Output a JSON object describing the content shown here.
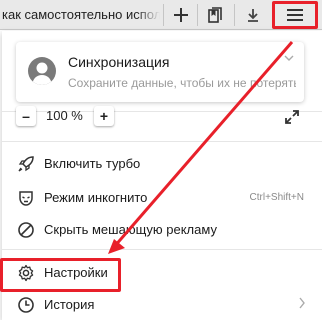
{
  "tab": {
    "title": "как самостоятельно испол"
  },
  "sync": {
    "title": "Синхронизация",
    "subtitle": "Сохраните данные, чтобы их не потерять"
  },
  "zoom": {
    "minus": "–",
    "value": "100 %",
    "plus": "+"
  },
  "menu": {
    "turbo": "Включить турбо",
    "incognito": "Режим инкогнито",
    "incognito_shortcut": "Ctrl+Shift+N",
    "hide_ads": "Скрыть мешающую рекламу",
    "settings": "Настройки",
    "history": "История"
  },
  "colors": {
    "annotation_red": "#e8202a"
  }
}
